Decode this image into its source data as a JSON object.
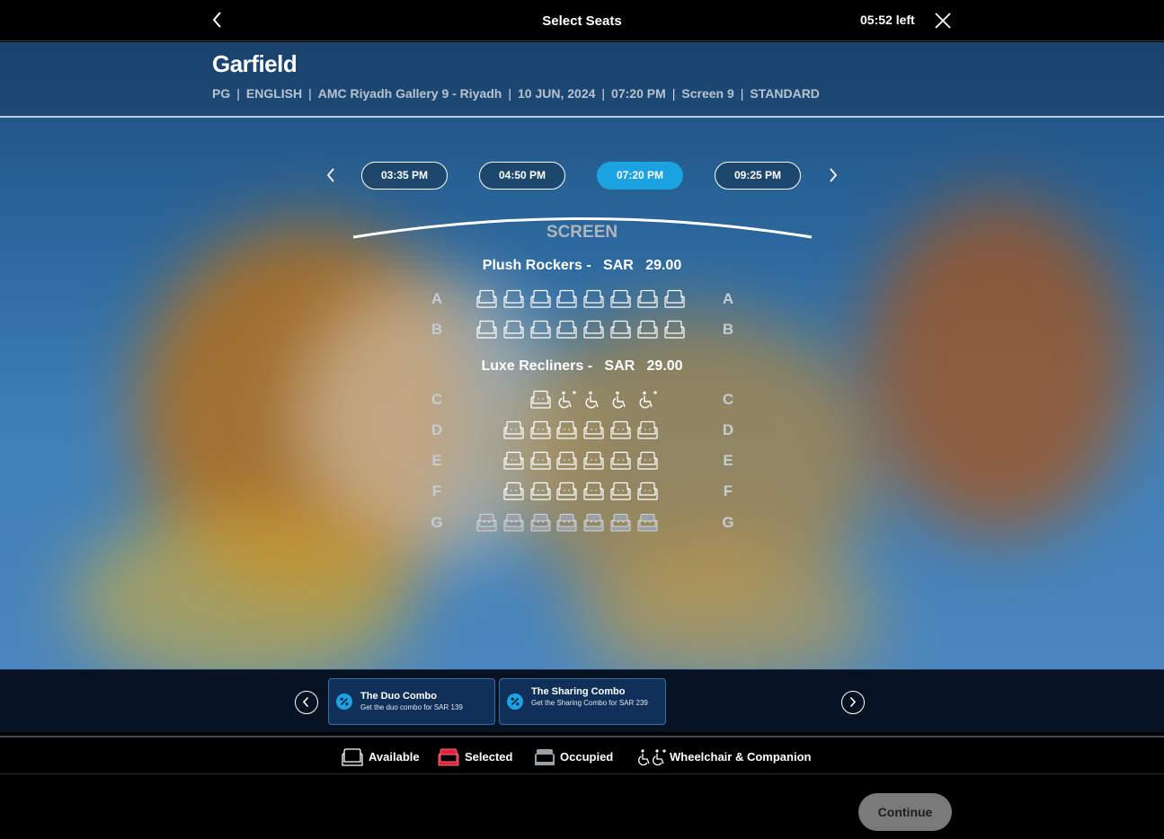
{
  "header": {
    "title": "Select Seats",
    "timer": "05:52 left"
  },
  "movie": {
    "title": "Garfield",
    "meta": [
      "PG",
      "ENGLISH",
      "AMC Riyadh Gallery 9 - Riyadh",
      "10 JUN, 2024",
      "07:20 PM",
      "Screen 9",
      "STANDARD"
    ]
  },
  "showtimes": [
    {
      "label": "03:35 PM",
      "selected": false
    },
    {
      "label": "04:50 PM",
      "selected": false
    },
    {
      "label": "07:20 PM",
      "selected": true
    },
    {
      "label": "09:25 PM",
      "selected": false
    }
  ],
  "screen_label": "SCREEN",
  "sections": [
    {
      "name": "Plush Rockers -",
      "currency": "SAR",
      "price": "29.00",
      "rows": [
        {
          "label": "A",
          "seats": [
            "rocker",
            "rocker",
            "rocker",
            "rocker",
            "rocker",
            "rocker",
            "rocker",
            "rocker"
          ]
        },
        {
          "label": "B",
          "seats": [
            "rocker",
            "rocker",
            "rocker",
            "rocker",
            "rocker",
            "rocker",
            "rocker",
            "rocker"
          ]
        }
      ]
    },
    {
      "name": "Luxe Recliners -",
      "currency": "SAR",
      "price": "29.00",
      "rows": [
        {
          "label": "C",
          "seats": [
            "",
            "",
            "available",
            "companion",
            "wheelchair",
            "wheelchair",
            "companion"
          ]
        },
        {
          "label": "D",
          "seats": [
            "",
            "available",
            "available",
            "available",
            "available",
            "available",
            "available"
          ]
        },
        {
          "label": "E",
          "seats": [
            "",
            "available",
            "available",
            "available",
            "available",
            "available",
            "available"
          ]
        },
        {
          "label": "F",
          "seats": [
            "",
            "available",
            "available",
            "available",
            "available",
            "available",
            "available"
          ]
        },
        {
          "label": "G",
          "seats": [
            "occupied",
            "occupied",
            "occupied",
            "occupied",
            "occupied",
            "occupied",
            "occupied"
          ]
        }
      ]
    }
  ],
  "combos": [
    {
      "title": "The Duo Combo",
      "description": "Get the duo combo for SAR 139"
    },
    {
      "title": "The Sharing Combo",
      "description": "Get the Sharing Combo for SAR 239"
    }
  ],
  "legend": {
    "available": "Available",
    "selected": "Selected",
    "occupied": "Occupied",
    "wheelchair": "Wheelchair & Companion"
  },
  "continue_label": "Continue",
  "colors": {
    "accent": "#1aa3e0",
    "selected_seat": "#e0203a",
    "occupied_seat": "#9aa0a6",
    "continue_bg": "#7a7a7a"
  }
}
